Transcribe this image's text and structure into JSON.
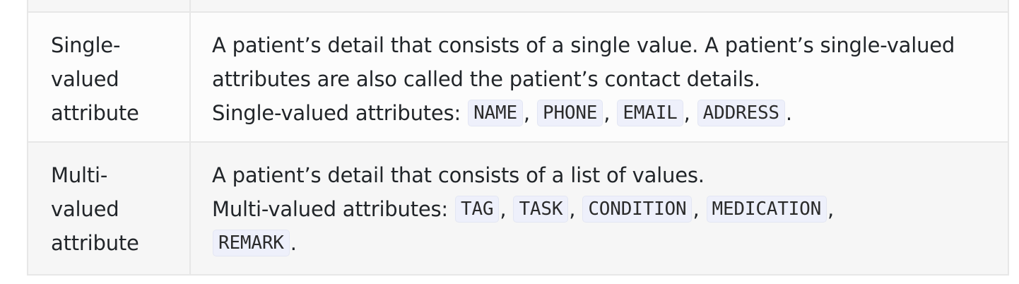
{
  "rows": [
    {
      "term_lines": [
        "Single-",
        "valued",
        "attribute"
      ],
      "desc_line1": "A patient’s detail that consists of a single value. A patient’s single-valued",
      "desc_line2": "attributes are also called the patient’s contact details.",
      "list_label": "Single-valued attributes:",
      "codes": [
        "NAME",
        "PHONE",
        "EMAIL",
        "ADDRESS"
      ]
    },
    {
      "term_lines": [
        "Multi-",
        "valued",
        "attribute"
      ],
      "desc_line1": "A patient’s detail that consists of a list of values.",
      "list_label": "Multi-valued attributes:",
      "codes": [
        "TAG",
        "TASK",
        "CONDITION",
        "MEDICATION",
        "REMARK"
      ]
    }
  ],
  "separator": ",",
  "terminator": "."
}
